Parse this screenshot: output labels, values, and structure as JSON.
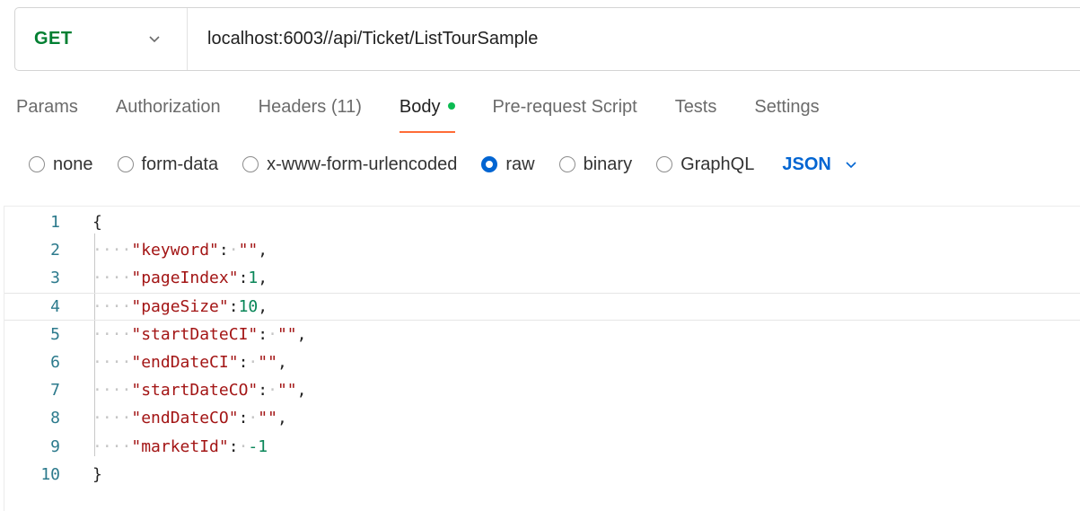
{
  "request": {
    "method": "GET",
    "url": "localhost:6003//api/Ticket/ListTourSample"
  },
  "tabs": [
    {
      "label": "Params"
    },
    {
      "label": "Authorization"
    },
    {
      "label": "Headers",
      "count": "(11)"
    },
    {
      "label": "Body",
      "active": true,
      "indicator": "green-dot"
    },
    {
      "label": "Pre-request Script"
    },
    {
      "label": "Tests"
    },
    {
      "label": "Settings"
    }
  ],
  "body_types": [
    {
      "label": "none",
      "checked": false
    },
    {
      "label": "form-data",
      "checked": false
    },
    {
      "label": "x-www-form-urlencoded",
      "checked": false
    },
    {
      "label": "raw",
      "checked": true
    },
    {
      "label": "binary",
      "checked": false
    },
    {
      "label": "GraphQL",
      "checked": false
    }
  ],
  "format": "JSON",
  "editor": {
    "lines": [
      {
        "num": "1",
        "text": "{"
      },
      {
        "num": "2",
        "text": "    \"keyword\": \"\","
      },
      {
        "num": "3",
        "text": "    \"pageIndex\":1,"
      },
      {
        "num": "4",
        "text": "    \"pageSize\":10,"
      },
      {
        "num": "5",
        "text": "    \"startDateCI\": \"\","
      },
      {
        "num": "6",
        "text": "    \"endDateCI\": \"\","
      },
      {
        "num": "7",
        "text": "    \"startDateCO\": \"\","
      },
      {
        "num": "8",
        "text": "    \"endDateCO\": \"\","
      },
      {
        "num": "9",
        "text": "    \"marketId\": -1"
      },
      {
        "num": "10",
        "text": "}"
      }
    ],
    "highlighted_line": "4"
  },
  "colors": {
    "method": "#007f31",
    "accent": "#ff6c37",
    "radio_selected": "#0265d2",
    "body_dot": "#0cbb52",
    "json_key": "#a31515",
    "json_number": "#098658",
    "line_number": "#2c7a8c"
  }
}
